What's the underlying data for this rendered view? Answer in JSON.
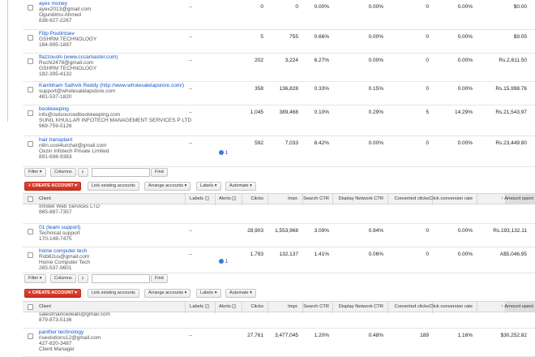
{
  "panel1": {
    "rows": [
      {
        "name": "ayex money",
        "lines": [
          "ayex2013@gmail.com",
          "Ogundimu Ahmed",
          "838-927-2267"
        ],
        "labels": "--",
        "alerts": "",
        "clicks": "0",
        "impr": "0",
        "ctr": "0.00%",
        "dnctr": "0.00%",
        "conv": "0",
        "convrate": "0.00%",
        "spent": "$0.00"
      },
      {
        "name": "Filip Poulintsev",
        "lines": [
          "GSHRM TECHNOLOGY",
          "184-995-1887"
        ],
        "labels": "--",
        "alerts": "",
        "clicks": "5",
        "impr": "755",
        "ctr": "0.66%",
        "dnctr": "0.00%",
        "conv": "0",
        "convrate": "0.00%",
        "spent": "$9.05"
      },
      {
        "name": "flazzoushi (www.cccamaster.com)",
        "lines": [
          "Ruchi2478@gmail.com",
          "GSHRM TECHNOLOGY",
          "182-395-4132"
        ],
        "labels": "--",
        "alerts": "",
        "clicks": "202",
        "impr": "3,224",
        "ctr": "6.27%",
        "dnctr": "0.00%",
        "conv": "0",
        "convrate": "0.00%",
        "spent": "Rs.2,611.50"
      },
      {
        "name": "Kambham Sathvik Reddy (http://www.wholesalelapstore.com/)",
        "lines": [
          "support@wholesalelapstore.com",
          "481-537-1820"
        ],
        "labels": "--",
        "alerts": "",
        "clicks": "358",
        "impr": "136,828",
        "ctr": "0.33%",
        "dnctr": "0.15%",
        "conv": "0",
        "convrate": "0.00%",
        "spent": "Rs.15,998.76"
      },
      {
        "name": "bookkeeping",
        "lines": [
          "info@outsourcedbookkeeping.com",
          "SUNIL KHULLAR INFOTECH MANAGEMENT SERVICES P LTD",
          "969-759-5126"
        ],
        "labels": "--",
        "alerts": "",
        "clicks": "1,045",
        "impr": "389,468",
        "ctr": "0.10%",
        "dnctr": "0.29%",
        "conv": "5",
        "convrate": "14.29%",
        "spent": "Rs.21,543.97"
      },
      {
        "name": "hair transplant",
        "lines": [
          "nitin.cool4urchat@gmail.com",
          "Oxzin Infotech Private Limited",
          "891-698-9383"
        ],
        "labels": "--",
        "alerts": "1",
        "clicks": "592",
        "impr": "7,033",
        "ctr": "8.42%",
        "dnctr": "0.00%",
        "conv": "0",
        "convrate": "0.00%",
        "spent": "Rs.23,449.80"
      }
    ]
  },
  "filterbar": {
    "filter": "Filter ▾",
    "columns": "Columns",
    "find": "Find"
  },
  "actionbar": {
    "create": "+ CREATE ACCOUNT ▾",
    "link": "Link existing accounts",
    "arrange": "Arrange accounts ▾",
    "labels": "Labels ▾",
    "automate": "Automate ▾"
  },
  "headers": {
    "client": "Client",
    "labels": "Labels",
    "alerts": "Alerts",
    "clicks": "Clicks",
    "impr": "Impr.",
    "ctr": "Search CTR",
    "dnctr": "Display Network CTR",
    "conv": "Converted clicks",
    "convrate": "Click conversion rate",
    "spent": "↑ Amount spent"
  },
  "panel2": {
    "partial": {
      "lines": [
        "Infotek Web Services LTD",
        "865-887-7357"
      ]
    },
    "rows": [
      {
        "name": "01 (team support)",
        "lines": [
          "Technical support",
          "170-148-7475"
        ],
        "labels": "--",
        "alerts": "",
        "clicks": "28,903",
        "impr": "1,553,968",
        "ctr": "3.09%",
        "dnctr": "0.94%",
        "conv": "0",
        "convrate": "0.00%",
        "spent": "Rs.193,132.11"
      },
      {
        "name": "home computer tech",
        "lines": [
          "Rob82us@gmail.com",
          "Home Computer Tech",
          "265-537-9601"
        ],
        "labels": "--",
        "alerts": "1",
        "clicks": "1,793",
        "impr": "132,137",
        "ctr": "1.41%",
        "dnctr": "0.06%",
        "conv": "0",
        "convrate": "0.00%",
        "spent": "A$5,046.95"
      }
    ]
  },
  "panel3": {
    "partial": {
      "lines": [
        "salesfinancedeals@gmail.com",
        "879-873-5136"
      ]
    },
    "rows": [
      {
        "name": "panther technology",
        "lines": [
          "riseolutions12@gmail.com",
          "427-820-3487",
          "Client Manager"
        ],
        "labels": "--",
        "alerts": "",
        "clicks": "27,761",
        "impr": "3,477,045",
        "ctr": "1.20%",
        "dnctr": "0.48%",
        "conv": "189",
        "convrate": "1.16%",
        "spent": "$30,252.82"
      }
    ]
  }
}
